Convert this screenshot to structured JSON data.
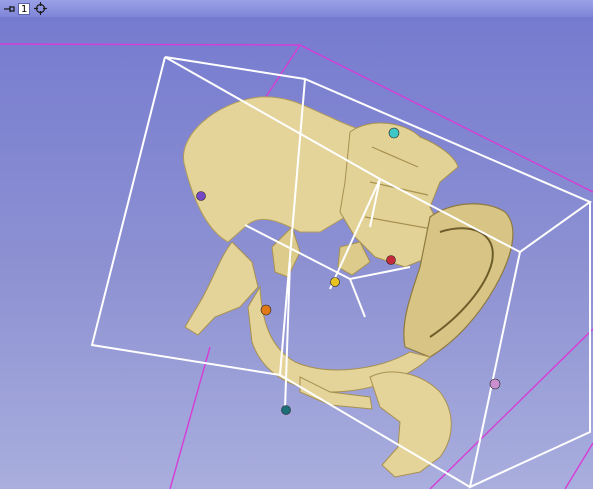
{
  "view": {
    "index_label": "1",
    "background_top": "#767bd0",
    "background_bottom": "#a9aede"
  },
  "colors": {
    "bone": "#e4d49a",
    "bone_shadow": "#b39d5a",
    "box_lines": "#ffffff",
    "slice_edges": "#d63cd6"
  },
  "icons": {
    "pin": "pin-icon",
    "center": "crosshair-icon"
  },
  "markups": [
    {
      "name": "cyan-point",
      "color": "#3ec7c4"
    },
    {
      "name": "purple-point",
      "color": "#7648c6"
    },
    {
      "name": "red-point",
      "color": "#c42a3a"
    },
    {
      "name": "yellow-point",
      "color": "#e7c221"
    },
    {
      "name": "orange-point",
      "color": "#e07a18"
    },
    {
      "name": "teal-point",
      "color": "#1c6e77"
    },
    {
      "name": "pink-point",
      "color": "#c98fcf"
    }
  ]
}
